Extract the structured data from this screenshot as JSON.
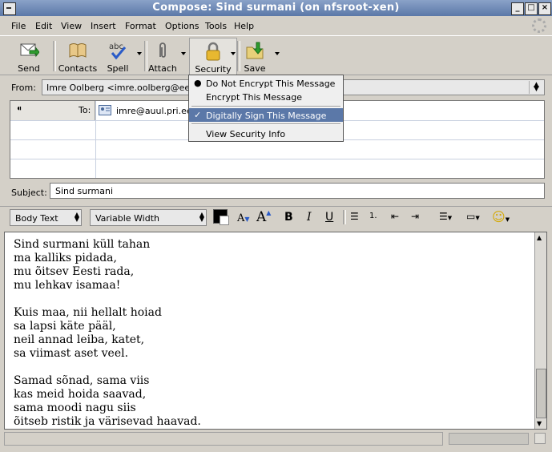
{
  "window": {
    "title": "Compose: Sind surmani (on nfsroot-xen)"
  },
  "menubar": [
    {
      "label": "File"
    },
    {
      "label": "Edit"
    },
    {
      "label": "View"
    },
    {
      "label": "Insert"
    },
    {
      "label": "Format"
    },
    {
      "label": "Options"
    },
    {
      "label": "Tools"
    },
    {
      "label": "Help"
    }
  ],
  "toolbar": {
    "send": "Send",
    "contacts": "Contacts",
    "spell": "Spell",
    "attach": "Attach",
    "security": "Security",
    "save": "Save"
  },
  "from": {
    "label": "From:",
    "value": "Imre Oolberg <imre.oolberg@eesti.ee>"
  },
  "recipients": {
    "type_label": "To:",
    "addresses": [
      "imre@auul.pri.ee"
    ]
  },
  "subject": {
    "label": "Subject:",
    "value": "Sind surmani"
  },
  "format": {
    "paragraph_style": "Body Text",
    "font": "Variable Width",
    "text_color": "#000000"
  },
  "body_text": "Sind surmani küll tahan\nma kalliks pidada,\nmu õitsev Eesti rada,\nmu lehkav isamaa!\n\nKuis maa, nii hellalt hoiad\nsa lapsi käte pääl,\nneil annad leiba, katet,\nsa viimast aset veel.\n\nSamad sõnad, sama viis\nkas meid hoida saavad,\nsama moodi nagu siis\nõitseb ristik ja värisevad haavad.",
  "security_menu": {
    "items": [
      {
        "label": "Do Not Encrypt This Message",
        "mark": "●"
      },
      {
        "label": "Encrypt This Message",
        "mark": ""
      },
      {
        "label": "Digitally Sign This Message",
        "mark": "✓"
      },
      {
        "label": "View Security Info",
        "mark": ""
      }
    ]
  },
  "colors": {
    "title_bar": "#5b78a8",
    "highlight": "#5b78a8",
    "background": "#d4d0c8"
  }
}
